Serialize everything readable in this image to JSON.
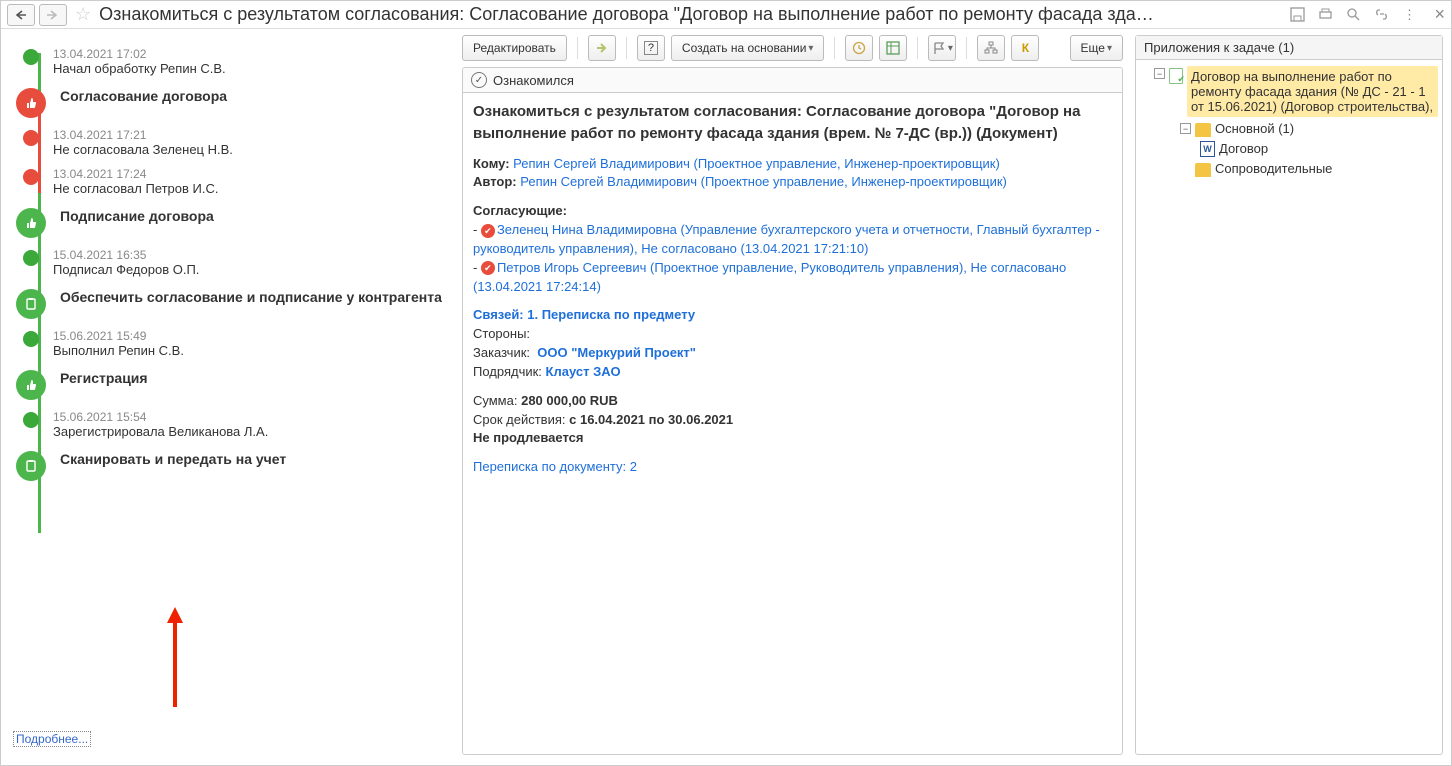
{
  "header": {
    "title": "Ознакомиться с результатом согласования: Согласование договора \"Договор  на  выполнение работ по ремонту фасада зда…"
  },
  "toolbar": {
    "edit": "Редактировать",
    "create_based_on": "Создать на основании",
    "k": "К",
    "more": "Еще"
  },
  "timeline": {
    "more": "Подробнее...",
    "items": [
      {
        "date": "13.04.2021 17:02",
        "text": "Начал обработку Репин С.В."
      },
      {
        "title": "Согласование договора"
      },
      {
        "date": "13.04.2021 17:21",
        "text": "Не согласовала Зеленец Н.В."
      },
      {
        "date": "13.04.2021 17:24",
        "text": "Не согласовал Петров И.С."
      },
      {
        "title": "Подписание договора"
      },
      {
        "date": "15.04.2021 16:35",
        "text": "Подписал Федоров О.П."
      },
      {
        "title": "Обеспечить согласование и подписание у контрагента"
      },
      {
        "date": "15.06.2021 15:49",
        "text": "Выполнил Репин С.В."
      },
      {
        "title": "Регистрация"
      },
      {
        "date": "15.06.2021 15:54",
        "text": "Зарегистрировала Великанова Л.А."
      },
      {
        "title": "Сканировать и передать на учет"
      }
    ]
  },
  "doc": {
    "ack": "Ознакомился",
    "heading": "Ознакомиться с результатом согласования: Согласование договора \"Договор  на  выполнение работ по ремонту фасада здания (врем. № 7-ДС (вр.)) (Документ)",
    "whom_lbl": "Кому:",
    "whom": "Репин Сергей Владимирович (Проектное управление, Инженер-проектировщик)",
    "author_lbl": "Автор:",
    "author": "Репин Сергей Владимирович (Проектное управление, Инженер-проектировщик)",
    "approvers_lbl": "Согласующие:",
    "approver1": "Зеленец Нина Владимировна (Управление бухгалтерского учета и отчетности, Главный бухгалтер - руководитель управления), Не согласовано (13.04.2021 17:21:10)",
    "approver2": "Петров Игорь Сергеевич (Проектное управление, Руководитель управления), Не согласовано (13.04.2021 17:24:14)",
    "links_lbl": "Связей: 1. Переписка по предмету",
    "sides": "Стороны:",
    "cust_lbl": "Заказчик:",
    "cust": "ООО \"Меркурий Проект\"",
    "contr_lbl": "Подрядчик:",
    "contr": "Клауст ЗАО",
    "amount_lbl": "Сумма:",
    "amount": "280 000,00 RUB",
    "period_lbl": "Срок действия:",
    "period": "с 16.04.2021 по 30.06.2021",
    "noext": "Не продлевается",
    "corr_lbl": "Переписка по документу:",
    "corr_cnt": "2"
  },
  "attachments": {
    "header": "Приложения к задаче (1)",
    "root": "Договор  на  выполнение работ по ремонту фасада здания (№ ДС - 21 - 1 от 15.06.2021) (Договор строительства),",
    "folder_main": "Основной (1)",
    "file1": "Договор",
    "folder_other": "Сопроводительные"
  }
}
